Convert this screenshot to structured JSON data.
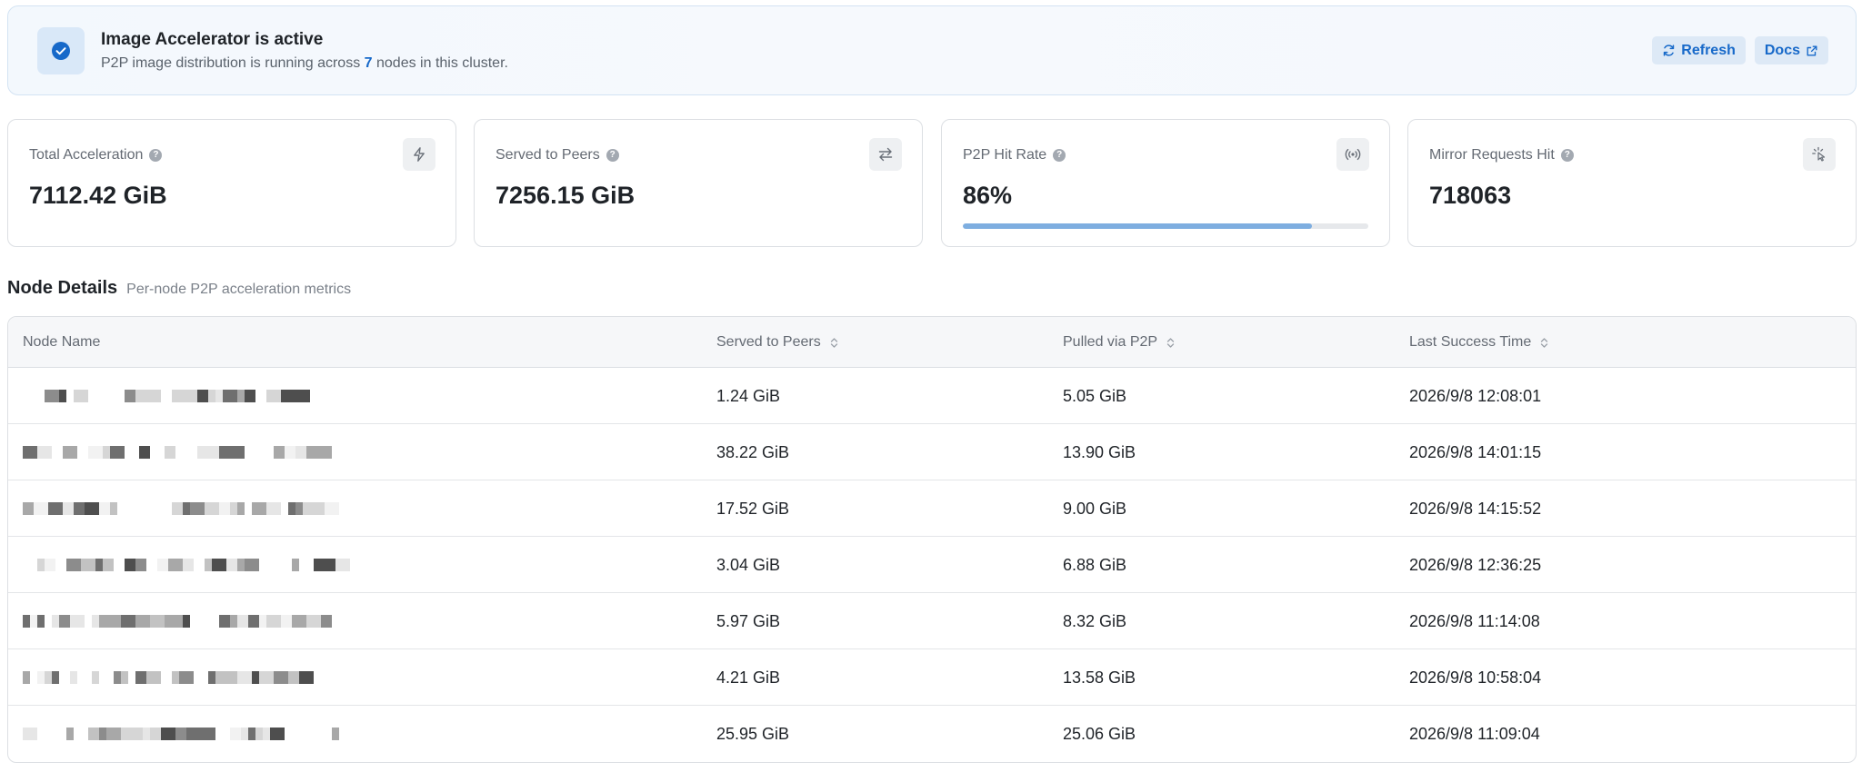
{
  "banner": {
    "title": "Image Accelerator is active",
    "subtitle_prefix": "P2P image distribution is running across",
    "node_count": "7",
    "subtitle_suffix": "nodes in this cluster.",
    "status_icon": "check-circle-icon",
    "actions": [
      {
        "label": "Refresh",
        "icon": "refresh-icon"
      },
      {
        "label": "Docs",
        "icon": "external-link-icon"
      }
    ]
  },
  "stats": [
    {
      "label": "Total Acceleration",
      "value": "7112.42 GiB",
      "icon": "lightning-icon"
    },
    {
      "label": "Served to Peers",
      "value": "7256.15 GiB",
      "icon": "swap-arrows-icon"
    },
    {
      "label": "P2P Hit Rate",
      "value": "86%",
      "icon": "broadcast-icon",
      "progress": 0.86
    },
    {
      "label": "Mirror Requests Hit",
      "value": "718063",
      "icon": "click-pointer-icon"
    }
  ],
  "section": {
    "title": "Node Details",
    "subtitle": "Per-node P2P acceleration metrics"
  },
  "table": {
    "columns": [
      "Node Name",
      "Served to Peers",
      "Pulled via P2P",
      "Last Success Time"
    ],
    "rows": [
      {
        "served": "1.24 GiB",
        "pulled": "5.05 GiB",
        "time": "2026/9/8 12:08:01"
      },
      {
        "served": "38.22 GiB",
        "pulled": "13.90 GiB",
        "time": "2026/9/8 14:01:15"
      },
      {
        "served": "17.52 GiB",
        "pulled": "9.00 GiB",
        "time": "2026/9/8 14:15:52"
      },
      {
        "served": "3.04 GiB",
        "pulled": "6.88 GiB",
        "time": "2026/9/8 12:36:25"
      },
      {
        "served": "5.97 GiB",
        "pulled": "8.32 GiB",
        "time": "2026/9/8 11:14:08"
      },
      {
        "served": "4.21 GiB",
        "pulled": "13.58 GiB",
        "time": "2026/9/8 10:58:04"
      },
      {
        "served": "25.95 GiB",
        "pulled": "25.06 GiB",
        "time": "2026/9/8 11:09:04"
      }
    ]
  },
  "colors": {
    "accent": "#1769c9",
    "progress": "#7eaee0",
    "border": "#dcdfe3"
  }
}
